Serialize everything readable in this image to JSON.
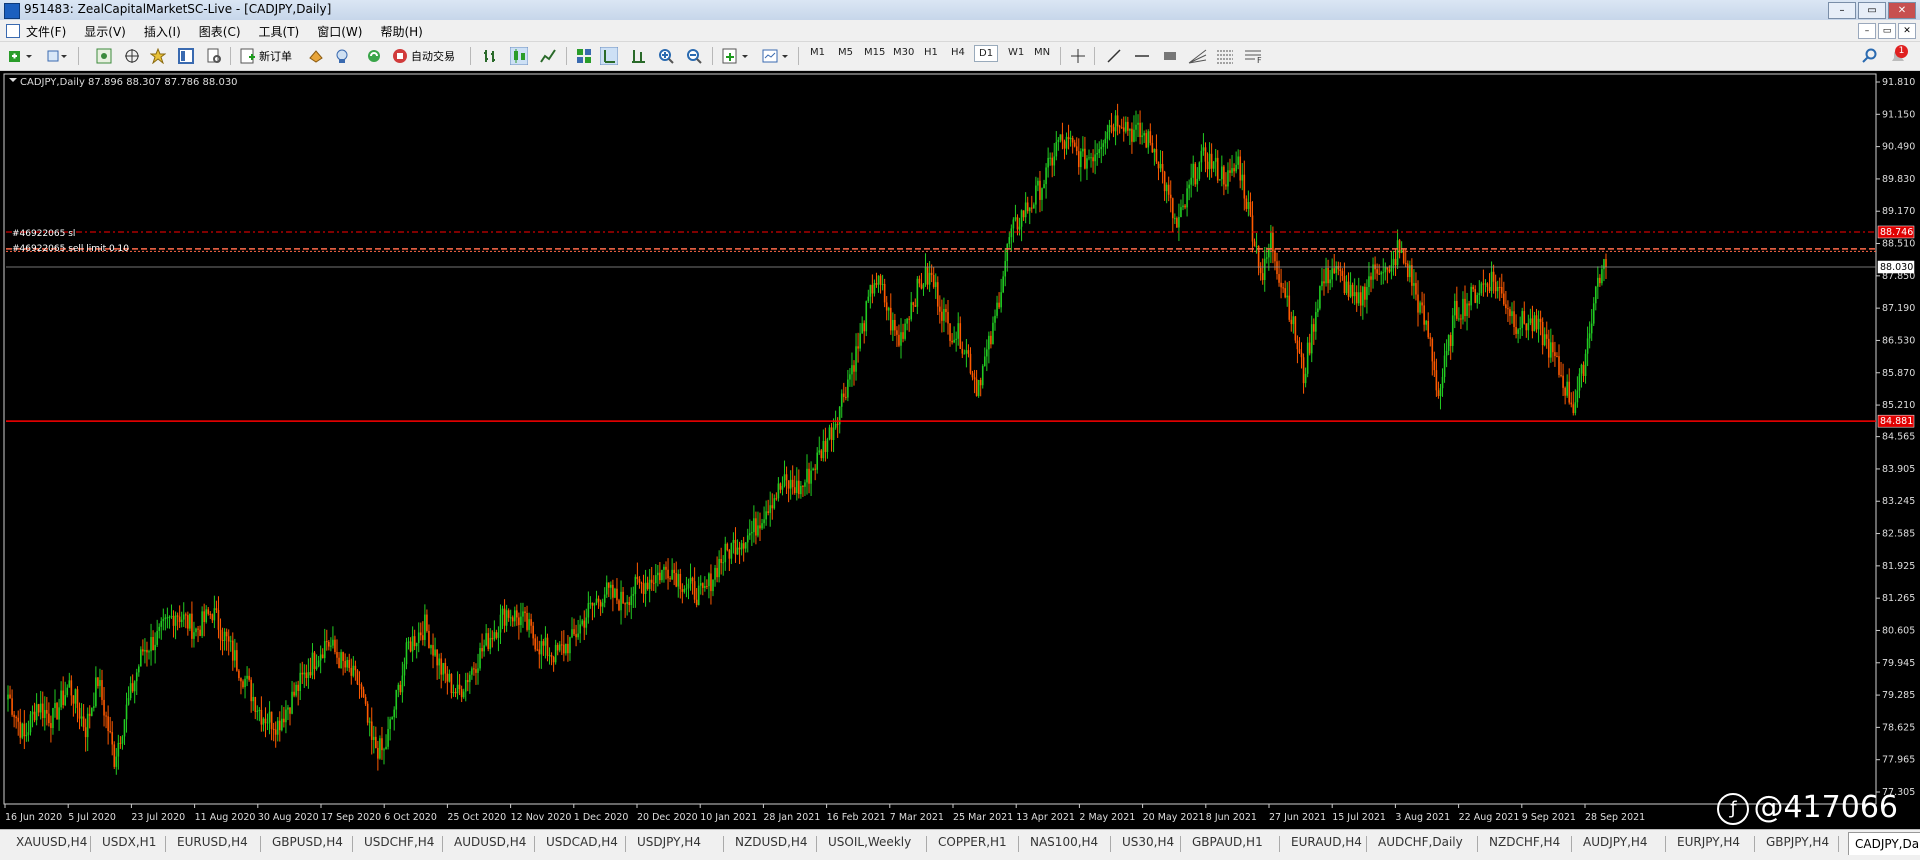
{
  "window": {
    "title": "951483: ZealCapitalMarketSC-Live - [CADJPY,Daily]",
    "buttons": [
      "–",
      "▭",
      "✕"
    ]
  },
  "menu": {
    "items": [
      "文件(F)",
      "显示(V)",
      "插入(I)",
      "图表(C)",
      "工具(T)",
      "窗口(W)",
      "帮助(H)"
    ],
    "mdi_buttons": [
      "–",
      "▭",
      "✕"
    ]
  },
  "toolbar": {
    "new_order_label": "新订单",
    "auto_trade_label": "自动交易",
    "timeframes": [
      "M1",
      "M5",
      "M15",
      "M30",
      "H1",
      "H4",
      "D1",
      "W1",
      "MN"
    ],
    "active_timeframe": "D1",
    "notification_count": "1"
  },
  "chart": {
    "header_text": "CADJPY,Daily  87.896 88.307 87.786 88.030",
    "sl_label": "#46922065 sl",
    "limit_label": "#46922065 sell limit 0.10",
    "current_price_label": "88.030",
    "support_price_label": "84.881",
    "sl_price_label": "88.746",
    "price_ticks": [
      "91.810",
      "91.150",
      "90.490",
      "89.830",
      "89.170",
      "88.510",
      "87.850",
      "87.190",
      "86.530",
      "85.870",
      "85.210",
      "84.565",
      "83.905",
      "83.245",
      "82.585",
      "81.925",
      "81.265",
      "80.605",
      "79.945",
      "79.285",
      "78.625",
      "77.965",
      "77.305"
    ],
    "date_ticks": [
      "16 Jun 2020",
      "5 Jul 2020",
      "23 Jul 2020",
      "11 Aug 2020",
      "30 Aug 2020",
      "17 Sep 2020",
      "6 Oct 2020",
      "25 Oct 2020",
      "12 Nov 2020",
      "1 Dec 2020",
      "20 Dec 2020",
      "10 Jan 2021",
      "28 Jan 2021",
      "16 Feb 2021",
      "7 Mar 2021",
      "25 Mar 2021",
      "13 Apr 2021",
      "2 May 2021",
      "20 May 2021",
      "8 Jun 2021",
      "27 Jun 2021",
      "15 Jul 2021",
      "3 Aug 2021",
      "22 Aug 2021",
      "9 Sep 2021",
      "28 Sep 2021"
    ],
    "colors": {
      "up": "#22cc22",
      "down": "#ff5a00",
      "level": "#ff0000",
      "limit": "#ff6a4a",
      "bg": "#000000"
    }
  },
  "chart_data": {
    "type": "candlestick",
    "symbol": "CADJPY",
    "timeframe": "Daily",
    "ylim": [
      77.305,
      91.81
    ],
    "ohlc_last": {
      "open": 87.896,
      "high": 88.307,
      "low": 87.786,
      "close": 88.03
    },
    "horizontal_levels": {
      "sl": 88.746,
      "sell_limit": 88.4,
      "support": 84.881,
      "current": 88.03
    },
    "anchors": [
      [
        0,
        79.3
      ],
      [
        8,
        78.4
      ],
      [
        14,
        79.1
      ],
      [
        22,
        78.8
      ],
      [
        30,
        79.5
      ],
      [
        38,
        78.6
      ],
      [
        44,
        79.6
      ],
      [
        52,
        78.0
      ],
      [
        58,
        79.0
      ],
      [
        66,
        80.2
      ],
      [
        74,
        80.5
      ],
      [
        82,
        81.0
      ],
      [
        92,
        80.6
      ],
      [
        100,
        81.0
      ],
      [
        108,
        80.3
      ],
      [
        116,
        79.6
      ],
      [
        124,
        78.9
      ],
      [
        132,
        78.7
      ],
      [
        140,
        79.3
      ],
      [
        148,
        79.9
      ],
      [
        156,
        80.4
      ],
      [
        164,
        79.9
      ],
      [
        172,
        79.5
      ],
      [
        178,
        78.3
      ],
      [
        184,
        78.1
      ],
      [
        190,
        79.2
      ],
      [
        196,
        80.3
      ],
      [
        204,
        80.7
      ],
      [
        212,
        79.8
      ],
      [
        220,
        79.3
      ],
      [
        228,
        79.9
      ],
      [
        236,
        80.5
      ],
      [
        244,
        81.0
      ],
      [
        252,
        80.8
      ],
      [
        260,
        80.3
      ],
      [
        268,
        80.1
      ],
      [
        276,
        80.4
      ],
      [
        284,
        81.0
      ],
      [
        292,
        81.4
      ],
      [
        300,
        81.2
      ],
      [
        308,
        81.5
      ],
      [
        316,
        81.7
      ],
      [
        324,
        81.9
      ],
      [
        332,
        81.5
      ],
      [
        340,
        81.3
      ],
      [
        348,
        82.0
      ],
      [
        356,
        82.4
      ],
      [
        364,
        82.6
      ],
      [
        372,
        83.2
      ],
      [
        380,
        83.6
      ],
      [
        388,
        83.5
      ],
      [
        396,
        84.1
      ],
      [
        404,
        84.8
      ],
      [
        410,
        85.6
      ],
      [
        416,
        86.4
      ],
      [
        420,
        87.1
      ],
      [
        424,
        87.8
      ],
      [
        428,
        87.5
      ],
      [
        432,
        86.9
      ],
      [
        436,
        86.5
      ],
      [
        442,
        87.3
      ],
      [
        448,
        87.8
      ],
      [
        452,
        87.8
      ],
      [
        456,
        87.3
      ],
      [
        460,
        86.8
      ],
      [
        466,
        86.6
      ],
      [
        470,
        86.2
      ],
      [
        474,
        85.6
      ],
      [
        478,
        86.1
      ],
      [
        482,
        86.7
      ],
      [
        486,
        87.7
      ],
      [
        490,
        88.6
      ],
      [
        496,
        89.1
      ],
      [
        502,
        89.4
      ],
      [
        508,
        89.9
      ],
      [
        514,
        90.6
      ],
      [
        520,
        90.5
      ],
      [
        526,
        90.2
      ],
      [
        532,
        90.4
      ],
      [
        538,
        90.9
      ],
      [
        544,
        91.1
      ],
      [
        550,
        90.8
      ],
      [
        556,
        90.7
      ],
      [
        562,
        90.4
      ],
      [
        568,
        89.4
      ],
      [
        572,
        88.8
      ],
      [
        576,
        89.3
      ],
      [
        580,
        89.9
      ],
      [
        586,
        90.3
      ],
      [
        592,
        90.0
      ],
      [
        598,
        89.8
      ],
      [
        602,
        90.2
      ],
      [
        606,
        89.4
      ],
      [
        610,
        88.6
      ],
      [
        614,
        87.8
      ],
      [
        618,
        88.6
      ],
      [
        622,
        87.9
      ],
      [
        626,
        87.4
      ],
      [
        630,
        86.6
      ],
      [
        634,
        85.8
      ],
      [
        638,
        86.7
      ],
      [
        642,
        87.6
      ],
      [
        648,
        88.0
      ],
      [
        654,
        87.7
      ],
      [
        660,
        87.2
      ],
      [
        666,
        87.8
      ],
      [
        672,
        88.1
      ],
      [
        676,
        87.8
      ],
      [
        680,
        88.4
      ],
      [
        686,
        87.9
      ],
      [
        690,
        87.3
      ],
      [
        696,
        86.5
      ],
      [
        700,
        85.4
      ],
      [
        704,
        86.2
      ],
      [
        708,
        87.1
      ],
      [
        714,
        87.3
      ],
      [
        720,
        87.6
      ],
      [
        726,
        87.8
      ],
      [
        732,
        87.4
      ],
      [
        738,
        86.9
      ],
      [
        744,
        86.9
      ],
      [
        750,
        86.7
      ],
      [
        754,
        86.4
      ],
      [
        758,
        86.0
      ],
      [
        762,
        85.6
      ],
      [
        766,
        85.2
      ],
      [
        770,
        85.8
      ],
      [
        774,
        86.8
      ],
      [
        778,
        87.8
      ],
      [
        782,
        88.03
      ]
    ],
    "anchors_note": ""
  },
  "tabs": {
    "items": [
      "XAUUSD,H4",
      "USDX,H1",
      "EURUSD,H4",
      "GBPUSD,H4",
      "USDCHF,H4",
      "AUDUSD,H4",
      "USDCAD,H4",
      "USDJPY,H4",
      "NZDUSD,H4",
      "USOIL,Weekly",
      "COPPER,H1",
      "NAS100,H4",
      "US30,H4",
      "GBPAUD,H1",
      "EURAUD,H4",
      "AUDCHF,Daily",
      "NZDCHF,H4",
      "AUDJPY,H4",
      "EURJPY,H4",
      "GBPJPY,H4",
      "CADJPY,Daily"
    ],
    "active": "CADJPY,Daily"
  },
  "watermark": {
    "text": "@417066"
  }
}
